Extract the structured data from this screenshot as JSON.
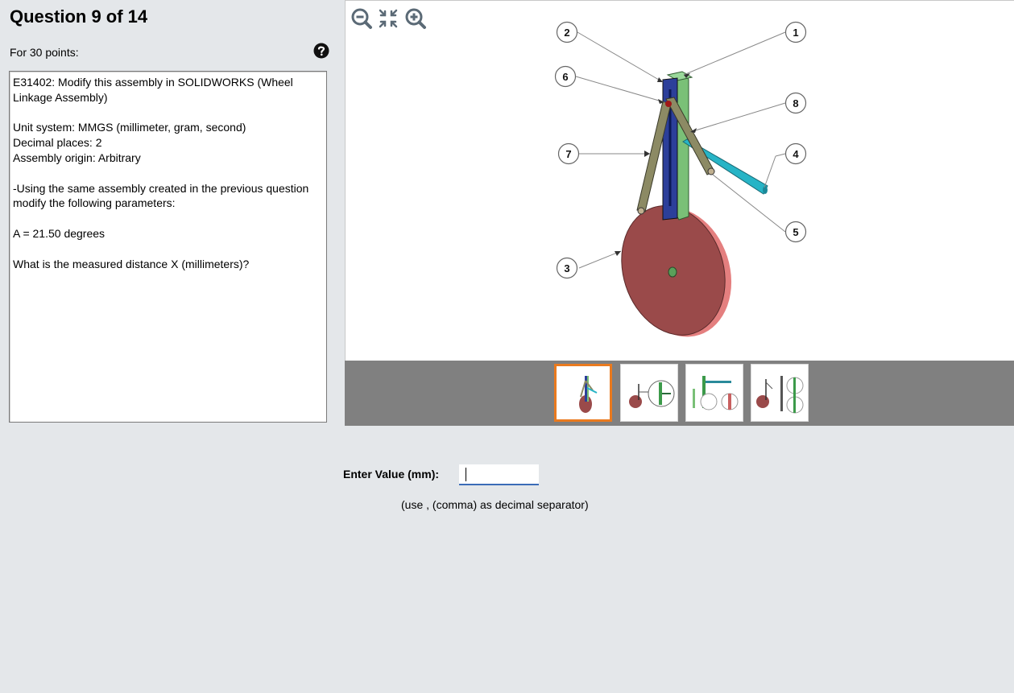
{
  "question": {
    "title": "Question 9 of 14",
    "points": "For 30 points:",
    "help_icon": "question-circle-icon",
    "text_lines": [
      "E31402:  Modify this assembly in SOLIDWORKS (Wheel Linkage Assembly)",
      "",
      "Unit system: MMGS (millimeter, gram, second)",
      "Decimal places: 2",
      "Assembly origin: Arbitrary",
      "",
      "-Using the same assembly created in the previous question modify the following parameters:",
      "",
      "A = 21.50 degrees",
      "",
      "What is the measured distance X (millimeters)?"
    ]
  },
  "viewer": {
    "toolbar": {
      "zoom_out_icon": "zoom-out-icon",
      "fit_icon": "fit-to-window-icon",
      "zoom_in_icon": "zoom-in-icon"
    },
    "callouts": [
      "1",
      "2",
      "3",
      "4",
      "5",
      "6",
      "7",
      "8"
    ],
    "thumbnails": [
      {
        "label": "view-1",
        "active": true
      },
      {
        "label": "view-2",
        "active": false
      },
      {
        "label": "view-3",
        "active": false
      },
      {
        "label": "view-4",
        "active": false
      }
    ]
  },
  "answer": {
    "label": "Enter Value (mm):",
    "value": "",
    "hint": "(use , (comma) as decimal separator)"
  },
  "colors": {
    "background": "#e4e7ea",
    "thumb_active_border": "#ea7a1e",
    "input_underline": "#3b6cb7",
    "wheel": "#9a4a4a",
    "rail_blue": "#2c3f9a",
    "rail_green": "#7ac077",
    "link": "#8c8a64",
    "shaft": "#27b4c6"
  }
}
